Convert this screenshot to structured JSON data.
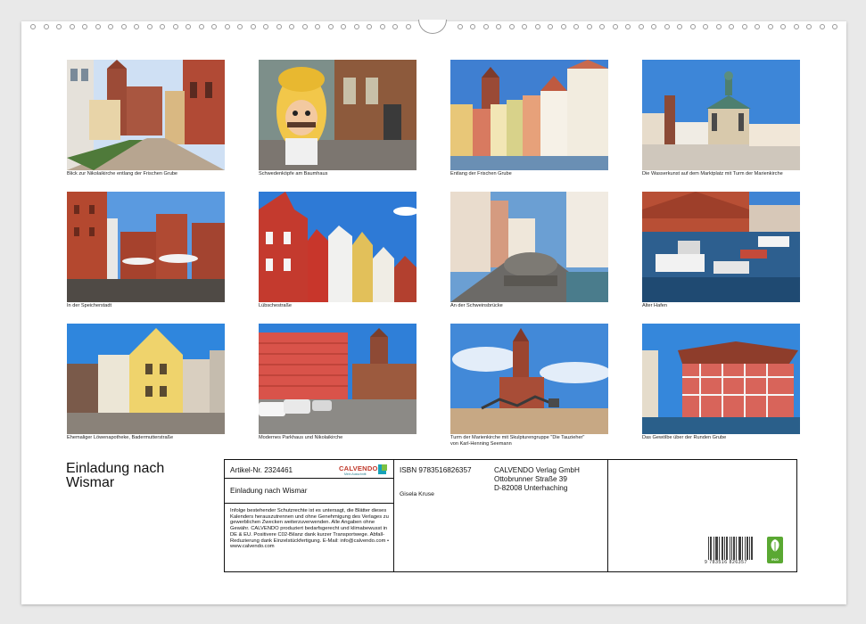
{
  "calendar": {
    "title": "Einladung nach Wismar",
    "title_line1": "Einladung nach",
    "title_line2": "Wismar"
  },
  "photos": [
    {
      "caption": "Blick zur Nikolaikirche entlang der Frischen Grube",
      "theme": "street-brick-church"
    },
    {
      "caption": "Schwedenköpfe am Baumhaus",
      "theme": "swedish-head"
    },
    {
      "caption": "Entlang der Frischen Grube",
      "theme": "canal-houses"
    },
    {
      "caption": "Die Wasserkunst auf dem Marktplatz mit Turm der Marienkirche",
      "theme": "wasserkunst"
    },
    {
      "caption": "In der Speicherstadt",
      "theme": "warehouses"
    },
    {
      "caption": "Lübschestraße",
      "theme": "gabled-houses"
    },
    {
      "caption": "An der Schweinsbrücke",
      "theme": "pig-statue"
    },
    {
      "caption": "Alter Hafen",
      "theme": "harbour"
    },
    {
      "caption": "Ehemaliger Löwenapotheke, Badermutterstraße",
      "theme": "apotheke"
    },
    {
      "caption": "Modernes Parkhaus und Nikolaikirche",
      "theme": "parkhaus"
    },
    {
      "caption": "Turm der Marienkirche mit Skulpturengruppe \"Die Tauzieher\"\nvon Karl-Henning Seemann",
      "theme": "marienkirche"
    },
    {
      "caption": "Das Gewölbe über der Runden Grube",
      "theme": "gewoelbe"
    }
  ],
  "info": {
    "article_label": "Artikel-Nr. 2324461",
    "product_title": "Einladung nach Wismar",
    "isbn": "ISBN 9783516826357",
    "author": "Gisela Kruse",
    "publisher_name": "CALVENDO Verlag GmbH",
    "publisher_street": "Ottobrunner Straße 39",
    "publisher_city": "D-82008 Unterhaching",
    "logo": "CALVENDO",
    "logo_sub": "Mein Ausschnitt",
    "legal_text": "Infolge bestehender Schutzrechte ist es untersagt, die Blätter dieses Kalenders herauszutrennen und ohne Genehmigung des Verlages zu gewerblichen Zwecken weiterzuverwenden. Alle Angaben ohne Gewähr. CALVENDO produziert bedarfsgerecht und klimabewusst in DE & EU. Positivere C02-Bilanz dank kurzer Transportwege. Abfall-Reduzierung dank Einzelstückfertigung. E-Mail: info@calvendo.com • www.calvendo.com",
    "barcode_number": "9 783516 826357",
    "eco_label": "eco"
  },
  "colors": {
    "sky": "#3f7fd1",
    "brick": "#a8432e",
    "eco_green": "#5aa832",
    "calvendo_red": "#c0392b"
  }
}
